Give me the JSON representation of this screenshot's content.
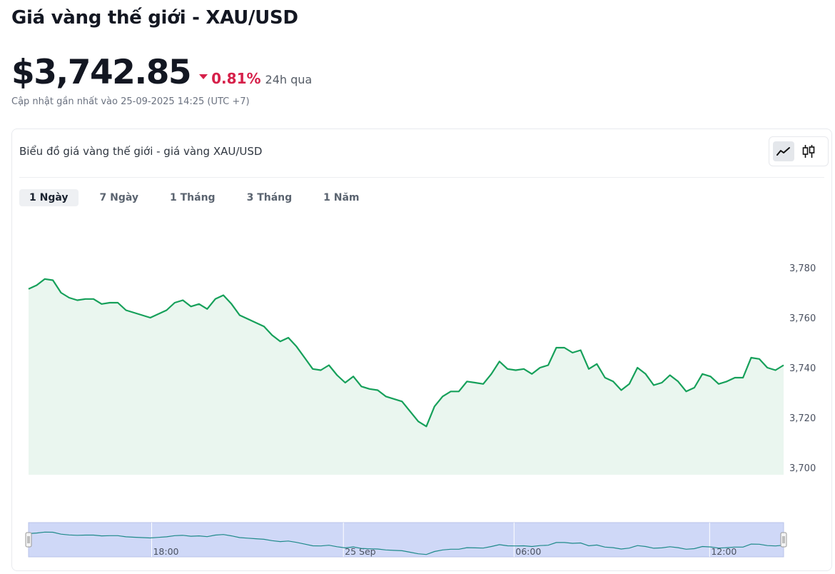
{
  "page": {
    "title": "Giá vàng thế giới - XAU/USD",
    "price": "$3,742.85",
    "change": "0.81%",
    "change_direction": "down",
    "period": "24h qua",
    "updated": "Cập nhật gần nhất vào 25-09-2025 14:25 (UTC +7)"
  },
  "card": {
    "title": "Biểu đồ giá vàng thế giới - giá vàng XAU/USD",
    "chart_mode_icons": [
      "line-chart-icon",
      "candlestick-chart-icon"
    ],
    "active_mode": "line",
    "tabs": [
      {
        "label": "1 Ngày",
        "active": true
      },
      {
        "label": "7 Ngày",
        "active": false
      },
      {
        "label": "1 Tháng",
        "active": false
      },
      {
        "label": "3 Tháng",
        "active": false
      },
      {
        "label": "1 Năm",
        "active": false
      }
    ]
  },
  "colors": {
    "line": "#16a05a",
    "area": "#eaf6ef",
    "down": "#d6204a",
    "navigator_fill": "#cfd8f7",
    "navigator_line": "#1f8a8a"
  },
  "chart_data": {
    "type": "area",
    "ylim": [
      3700,
      3780
    ],
    "y_ticks": [
      "3,780",
      "3,760",
      "3,740",
      "3,720",
      "3,700"
    ],
    "y_tick_values": [
      3780,
      3760,
      3740,
      3720,
      3700
    ],
    "navigator_ticks": [
      "18:00",
      "25 Sep",
      "06:00",
      "12:00"
    ],
    "navigator_tick_positions": [
      0.163,
      0.417,
      0.643,
      0.902
    ],
    "values": [
      3771.5,
      3773.0,
      3775.5,
      3775.0,
      3770.0,
      3768.0,
      3767.0,
      3767.5,
      3767.5,
      3765.5,
      3766.0,
      3766.0,
      3763.0,
      3762.0,
      3761.0,
      3760.0,
      3761.5,
      3763.0,
      3766.0,
      3767.0,
      3764.5,
      3765.5,
      3763.5,
      3767.5,
      3769.0,
      3765.5,
      3761.0,
      3759.5,
      3758.0,
      3756.5,
      3753.0,
      3750.5,
      3752.0,
      3748.5,
      3744.0,
      3739.5,
      3739.0,
      3741.0,
      3737.0,
      3734.0,
      3736.5,
      3732.5,
      3731.5,
      3731.0,
      3728.5,
      3727.5,
      3726.5,
      3722.5,
      3718.5,
      3716.5,
      3724.5,
      3728.5,
      3730.5,
      3730.5,
      3734.5,
      3734.0,
      3733.5,
      3737.5,
      3742.5,
      3739.5,
      3739.0,
      3739.5,
      3737.5,
      3740.0,
      3741.0,
      3748.0,
      3748.0,
      3746.0,
      3747.0,
      3739.5,
      3741.5,
      3736.0,
      3734.5,
      3731.0,
      3733.5,
      3740.0,
      3737.5,
      3733.0,
      3734.0,
      3737.0,
      3734.5,
      3730.5,
      3732.0,
      3737.5,
      3736.5,
      3733.5,
      3734.5,
      3736.0,
      3736.0,
      3744.0,
      3743.5,
      3740.0,
      3739.0,
      3741.0
    ]
  }
}
